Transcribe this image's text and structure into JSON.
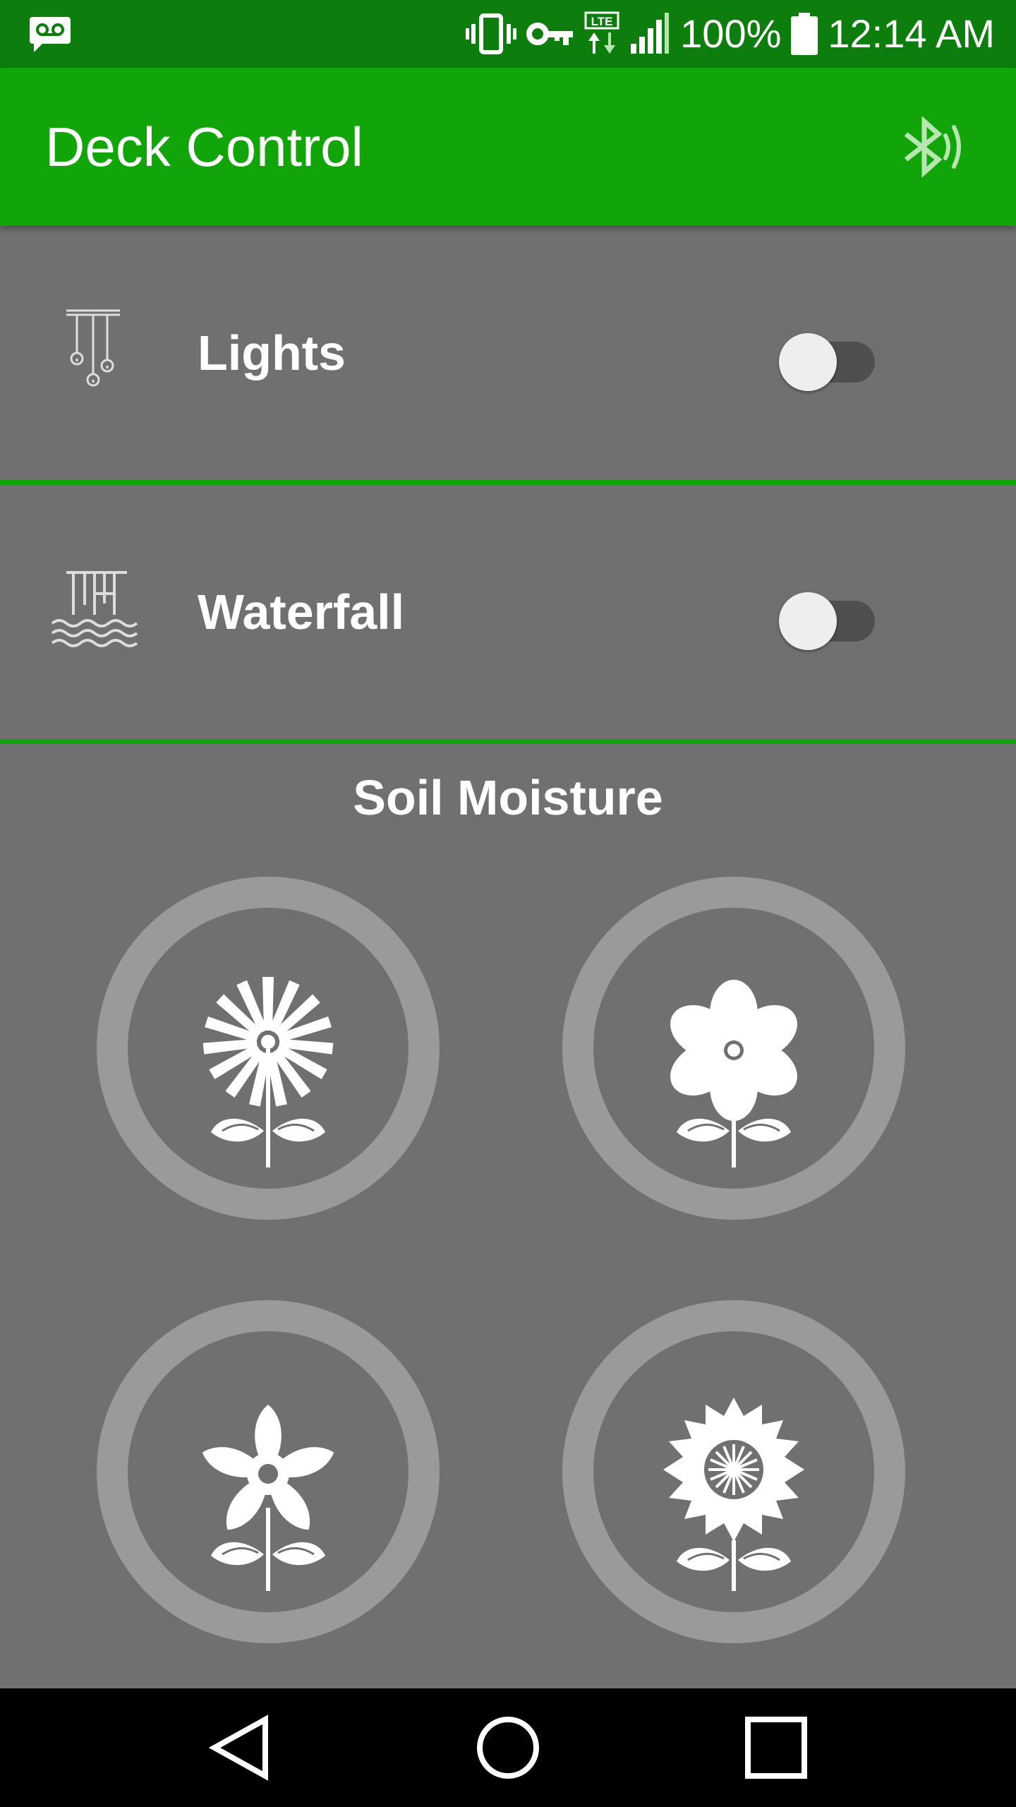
{
  "status_bar": {
    "battery_text": "100%",
    "time": "12:14 AM",
    "icons": [
      "voicemail-icon",
      "vibrate-icon",
      "vpn-key-icon",
      "lte-icon",
      "signal-icon",
      "battery-icon"
    ]
  },
  "app_bar": {
    "title": "Deck Control",
    "icon": "bluetooth-audio-icon"
  },
  "controls": [
    {
      "label": "Lights",
      "icon": "hanging-lights-icon",
      "on": false
    },
    {
      "label": "Waterfall",
      "icon": "waterfall-icon",
      "on": false
    }
  ],
  "soil_moisture": {
    "title": "Soil Moisture",
    "plants": [
      {
        "icon": "dandelion-flower-icon"
      },
      {
        "icon": "daisy-flower-icon"
      },
      {
        "icon": "star-flower-icon"
      },
      {
        "icon": "sunflower-icon"
      }
    ]
  },
  "nav_bar": {
    "icons": [
      "back-icon",
      "home-icon",
      "recents-icon"
    ]
  },
  "colors": {
    "status_bar": "#0d7d0d",
    "app_bar": "#12a50a",
    "background": "#707070",
    "ring": "#9a9a9a"
  }
}
